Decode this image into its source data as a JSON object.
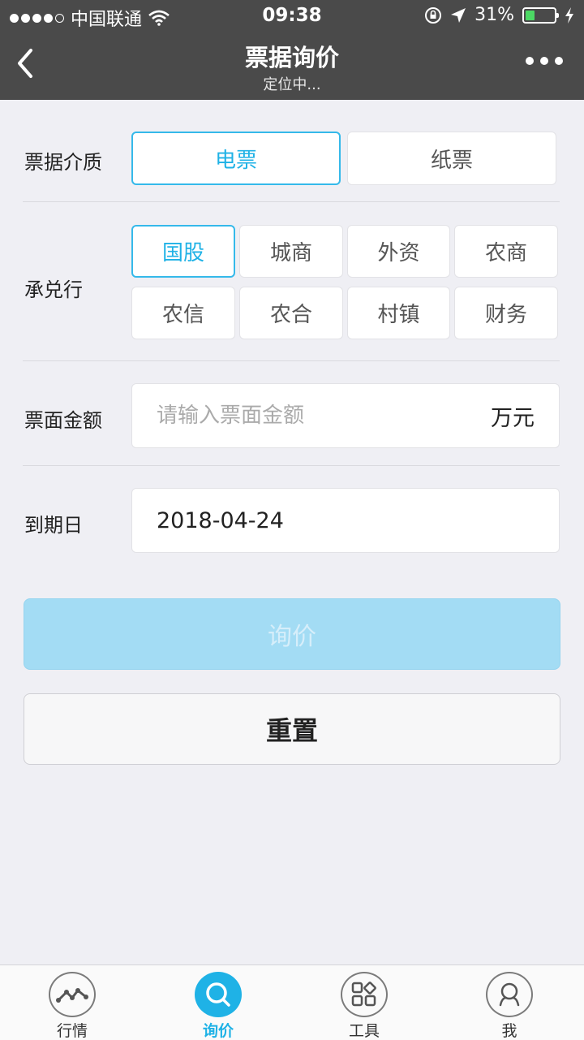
{
  "status_bar": {
    "carrier": "中国联通",
    "time": "09:38",
    "battery": "31%",
    "battery_level": 0.31
  },
  "nav": {
    "title": "票据询价",
    "subtitle": "定位中...",
    "back_icon": "chevron-left-icon",
    "more_icon": "more-dots-icon"
  },
  "form": {
    "medium": {
      "label": "票据介质",
      "options": [
        "电票",
        "纸票"
      ],
      "selected": "电票"
    },
    "acceptor": {
      "label": "承兑行",
      "options": [
        "国股",
        "城商",
        "外资",
        "农商",
        "农信",
        "农合",
        "村镇",
        "财务"
      ],
      "selected": "国股"
    },
    "amount": {
      "label": "票面金额",
      "placeholder": "请输入票面金额",
      "value": "",
      "unit": "万元"
    },
    "due_date": {
      "label": "到期日",
      "value": "2018-04-24"
    }
  },
  "actions": {
    "query_label": "询价",
    "reset_label": "重置"
  },
  "tabbar": {
    "items": [
      {
        "label": "行情",
        "icon": "trend-line-icon"
      },
      {
        "label": "询价",
        "icon": "search-icon"
      },
      {
        "label": "工具",
        "icon": "tools-grid-icon"
      },
      {
        "label": "我",
        "icon": "user-icon"
      }
    ],
    "active": "询价"
  },
  "colors": {
    "accent": "#1fb2e6",
    "nav_bg": "#4a4a4a",
    "page_bg": "#efeff4",
    "query_button_bg": "#a3dcf4"
  }
}
